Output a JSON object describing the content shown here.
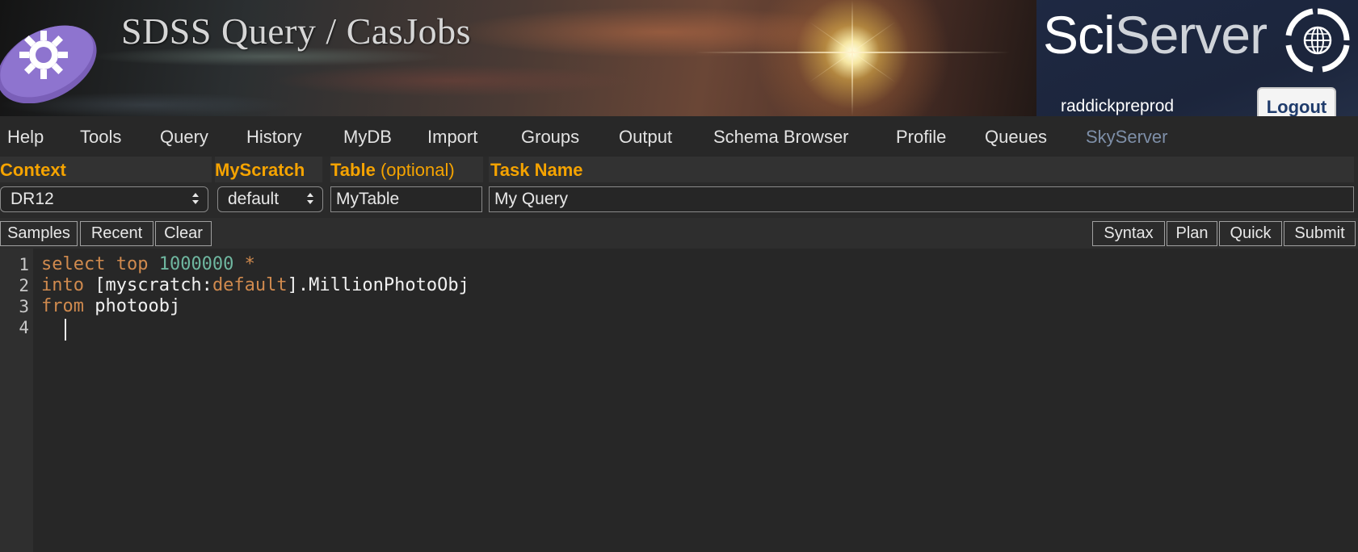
{
  "banner": {
    "title": "SDSS Query / CasJobs",
    "sciserver_brand": {
      "part1": "Sci",
      "part2": "Server"
    },
    "username": "raddickpreprod",
    "logout_label": "Logout"
  },
  "nav": {
    "items": [
      "Help",
      "Tools",
      "Query",
      "History",
      "MyDB",
      "Import",
      "Groups",
      "Output",
      "Schema Browser",
      "Profile",
      "Queues",
      "SkyServer"
    ]
  },
  "form": {
    "context_label": "Context",
    "myscratch_label": "MyScratch",
    "table_label": "Table",
    "table_optional": "(optional)",
    "taskname_label": "Task Name",
    "context_value": "DR12",
    "myscratch_value": "default",
    "table_value": "MyTable",
    "taskname_value": "My Query"
  },
  "toolbar": {
    "left": [
      "Samples",
      "Recent",
      "Clear"
    ],
    "right": [
      "Syntax",
      "Plan",
      "Quick",
      "Submit"
    ]
  },
  "editor": {
    "line_numbers": [
      "1",
      "2",
      "3",
      "4"
    ],
    "lines": [
      [
        {
          "t": "select top ",
          "c": "kw"
        },
        {
          "t": "1000000",
          "c": "num"
        },
        {
          "t": " *",
          "c": "kw"
        }
      ],
      [
        {
          "t": "into",
          "c": "kw"
        },
        {
          "t": " [myscratch:",
          "c": ""
        },
        {
          "t": "default",
          "c": "kw"
        },
        {
          "t": "].MillionPhotoObj",
          "c": ""
        }
      ],
      [
        {
          "t": "from",
          "c": "kw"
        },
        {
          "t": " photoobj",
          "c": ""
        }
      ],
      []
    ]
  },
  "colors": {
    "label_orange": "#f5a300",
    "keyword": "#d08a4e",
    "number": "#6fb7a0",
    "logout_text": "#1f3b6b"
  }
}
